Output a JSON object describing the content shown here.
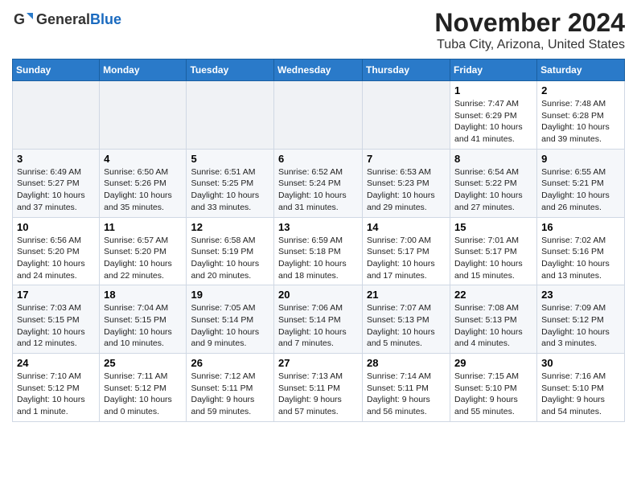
{
  "header": {
    "logo_general": "General",
    "logo_blue": "Blue",
    "title": "November 2024",
    "subtitle": "Tuba City, Arizona, United States"
  },
  "weekdays": [
    "Sunday",
    "Monday",
    "Tuesday",
    "Wednesday",
    "Thursday",
    "Friday",
    "Saturday"
  ],
  "weeks": [
    [
      {
        "day": "",
        "info": ""
      },
      {
        "day": "",
        "info": ""
      },
      {
        "day": "",
        "info": ""
      },
      {
        "day": "",
        "info": ""
      },
      {
        "day": "",
        "info": ""
      },
      {
        "day": "1",
        "info": "Sunrise: 7:47 AM\nSunset: 6:29 PM\nDaylight: 10 hours and 41 minutes."
      },
      {
        "day": "2",
        "info": "Sunrise: 7:48 AM\nSunset: 6:28 PM\nDaylight: 10 hours and 39 minutes."
      }
    ],
    [
      {
        "day": "3",
        "info": "Sunrise: 6:49 AM\nSunset: 5:27 PM\nDaylight: 10 hours and 37 minutes."
      },
      {
        "day": "4",
        "info": "Sunrise: 6:50 AM\nSunset: 5:26 PM\nDaylight: 10 hours and 35 minutes."
      },
      {
        "day": "5",
        "info": "Sunrise: 6:51 AM\nSunset: 5:25 PM\nDaylight: 10 hours and 33 minutes."
      },
      {
        "day": "6",
        "info": "Sunrise: 6:52 AM\nSunset: 5:24 PM\nDaylight: 10 hours and 31 minutes."
      },
      {
        "day": "7",
        "info": "Sunrise: 6:53 AM\nSunset: 5:23 PM\nDaylight: 10 hours and 29 minutes."
      },
      {
        "day": "8",
        "info": "Sunrise: 6:54 AM\nSunset: 5:22 PM\nDaylight: 10 hours and 27 minutes."
      },
      {
        "day": "9",
        "info": "Sunrise: 6:55 AM\nSunset: 5:21 PM\nDaylight: 10 hours and 26 minutes."
      }
    ],
    [
      {
        "day": "10",
        "info": "Sunrise: 6:56 AM\nSunset: 5:20 PM\nDaylight: 10 hours and 24 minutes."
      },
      {
        "day": "11",
        "info": "Sunrise: 6:57 AM\nSunset: 5:20 PM\nDaylight: 10 hours and 22 minutes."
      },
      {
        "day": "12",
        "info": "Sunrise: 6:58 AM\nSunset: 5:19 PM\nDaylight: 10 hours and 20 minutes."
      },
      {
        "day": "13",
        "info": "Sunrise: 6:59 AM\nSunset: 5:18 PM\nDaylight: 10 hours and 18 minutes."
      },
      {
        "day": "14",
        "info": "Sunrise: 7:00 AM\nSunset: 5:17 PM\nDaylight: 10 hours and 17 minutes."
      },
      {
        "day": "15",
        "info": "Sunrise: 7:01 AM\nSunset: 5:17 PM\nDaylight: 10 hours and 15 minutes."
      },
      {
        "day": "16",
        "info": "Sunrise: 7:02 AM\nSunset: 5:16 PM\nDaylight: 10 hours and 13 minutes."
      }
    ],
    [
      {
        "day": "17",
        "info": "Sunrise: 7:03 AM\nSunset: 5:15 PM\nDaylight: 10 hours and 12 minutes."
      },
      {
        "day": "18",
        "info": "Sunrise: 7:04 AM\nSunset: 5:15 PM\nDaylight: 10 hours and 10 minutes."
      },
      {
        "day": "19",
        "info": "Sunrise: 7:05 AM\nSunset: 5:14 PM\nDaylight: 10 hours and 9 minutes."
      },
      {
        "day": "20",
        "info": "Sunrise: 7:06 AM\nSunset: 5:14 PM\nDaylight: 10 hours and 7 minutes."
      },
      {
        "day": "21",
        "info": "Sunrise: 7:07 AM\nSunset: 5:13 PM\nDaylight: 10 hours and 5 minutes."
      },
      {
        "day": "22",
        "info": "Sunrise: 7:08 AM\nSunset: 5:13 PM\nDaylight: 10 hours and 4 minutes."
      },
      {
        "day": "23",
        "info": "Sunrise: 7:09 AM\nSunset: 5:12 PM\nDaylight: 10 hours and 3 minutes."
      }
    ],
    [
      {
        "day": "24",
        "info": "Sunrise: 7:10 AM\nSunset: 5:12 PM\nDaylight: 10 hours and 1 minute."
      },
      {
        "day": "25",
        "info": "Sunrise: 7:11 AM\nSunset: 5:12 PM\nDaylight: 10 hours and 0 minutes."
      },
      {
        "day": "26",
        "info": "Sunrise: 7:12 AM\nSunset: 5:11 PM\nDaylight: 9 hours and 59 minutes."
      },
      {
        "day": "27",
        "info": "Sunrise: 7:13 AM\nSunset: 5:11 PM\nDaylight: 9 hours and 57 minutes."
      },
      {
        "day": "28",
        "info": "Sunrise: 7:14 AM\nSunset: 5:11 PM\nDaylight: 9 hours and 56 minutes."
      },
      {
        "day": "29",
        "info": "Sunrise: 7:15 AM\nSunset: 5:10 PM\nDaylight: 9 hours and 55 minutes."
      },
      {
        "day": "30",
        "info": "Sunrise: 7:16 AM\nSunset: 5:10 PM\nDaylight: 9 hours and 54 minutes."
      }
    ]
  ]
}
